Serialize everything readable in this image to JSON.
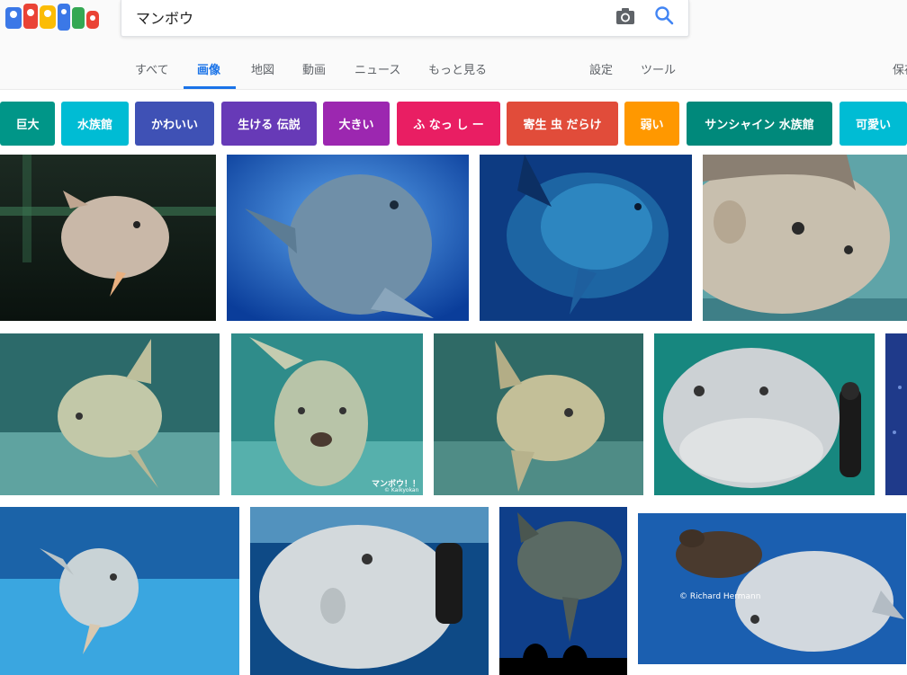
{
  "search": {
    "query": "マンボウ"
  },
  "tabs": [
    {
      "label": "すべて"
    },
    {
      "label": "画像"
    },
    {
      "label": "地図"
    },
    {
      "label": "動画"
    },
    {
      "label": "ニュース"
    },
    {
      "label": "もっと見る"
    },
    {
      "label": "設定"
    },
    {
      "label": "ツール"
    },
    {
      "label": "保存"
    }
  ],
  "chips": [
    {
      "label": "巨大",
      "color": "#009688"
    },
    {
      "label": "水族館",
      "color": "#00bcd4"
    },
    {
      "label": "かわいい",
      "color": "#3f51b5"
    },
    {
      "label": "生ける 伝説",
      "color": "#673ab7"
    },
    {
      "label": "大きい",
      "color": "#9c27b0"
    },
    {
      "label": "ふ なっ し ー",
      "color": "#e91e63"
    },
    {
      "label": "寄生 虫 だらけ",
      "color": "#e14c3a"
    },
    {
      "label": "弱い",
      "color": "#ff9800"
    },
    {
      "label": "サンシャイン 水族館",
      "color": "#00897b"
    },
    {
      "label": "可愛い",
      "color": "#00bcd4"
    }
  ],
  "images": {
    "tile_6_caption": "マンボウ！！",
    "tile_6_credit": "© Kaikyokan",
    "tile_13_credit": "© Richard Hermann"
  },
  "colors": {
    "accent": "#1a73e8"
  }
}
